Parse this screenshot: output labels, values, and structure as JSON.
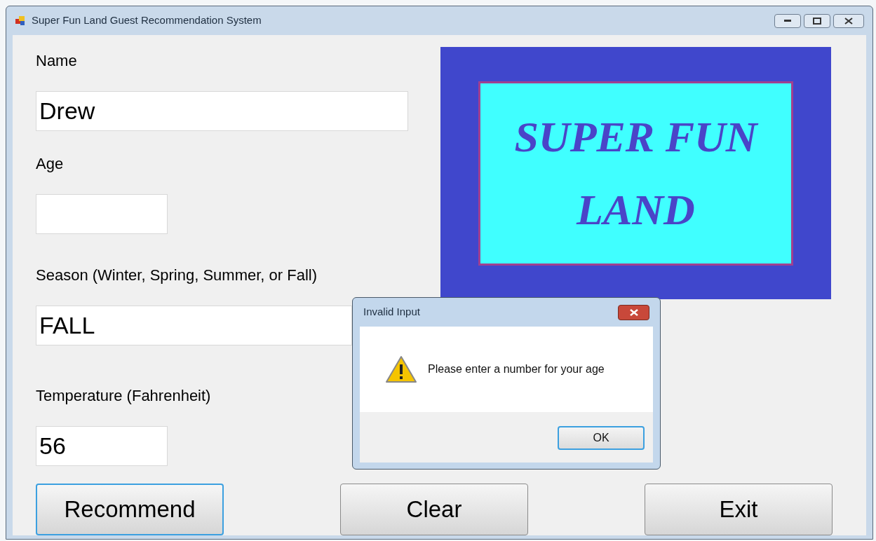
{
  "window": {
    "title": "Super Fun Land Guest Recommendation System"
  },
  "fields": [
    {
      "label": "Name",
      "value": "Drew"
    },
    {
      "label": "Age"
    },
    {
      "label": "Season (Winter, Spring, Summer, or Fall)",
      "value": "FALL"
    },
    {
      "label": "Temperature (Fahrenheit)",
      "value": "56"
    }
  ],
  "logo": {
    "text": "SUPER FUN LAND"
  },
  "buttons": [
    {
      "label": "Recommend",
      "focused": true
    },
    {
      "label": "Clear",
      "focused": false
    },
    {
      "label": "Exit",
      "focused": false
    }
  ],
  "dialog": {
    "title": "Invalid Input",
    "message": "Please enter a number for your age",
    "button": "OK"
  }
}
